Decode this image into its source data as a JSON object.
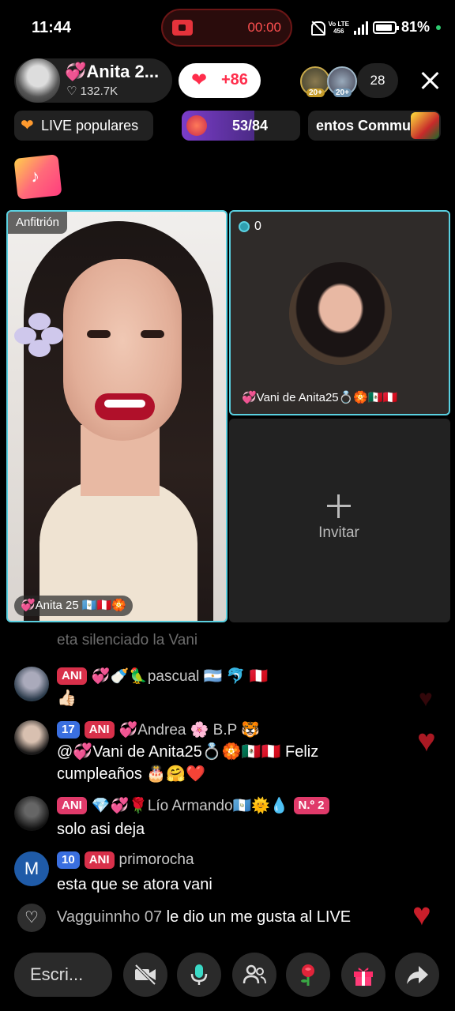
{
  "status_bar": {
    "time": "11:44",
    "recording_time": "00:00",
    "network": "Vo LTE",
    "network_speed": "456",
    "battery": "81%"
  },
  "host": {
    "name": "💞Anita 2...",
    "likes": "♡ 132.7K",
    "heart_count": "+86",
    "viewer_badges": [
      "20+",
      "20+"
    ],
    "viewer_count": "28"
  },
  "chips": {
    "live_popular": "LIVE populares",
    "rank": "53/84",
    "events": "entos Commu"
  },
  "panels": {
    "host_tag": "Anfitrión",
    "host_name": "💞Anita 25 🇬🇹🇵🇪🏵️",
    "guest_count": "0",
    "guest_name": "💞Vani de Anita25💍🏵️🇲🇽🇵🇪",
    "invite_label": "Invitar"
  },
  "chat": {
    "faded_message": "eta silenciado la Vani",
    "messages": [
      {
        "badges": [
          "ANI"
        ],
        "user": "💞🍼🦜pascual 🇦🇷 🐬 🇵🇪",
        "text": "👍🏻"
      },
      {
        "badges": [
          "17",
          "ANI"
        ],
        "user": "💞Andrea 🌸 B.P 🐯",
        "text": "@💞Vani de Anita25💍🏵️🇲🇽🇵🇪 Feliz cumpleaños 🎂🤗❤️"
      },
      {
        "badges": [
          "ANI"
        ],
        "user": "💎💞🌹Lío Armando🇬🇹🌞💧",
        "rank_badge": "N.º 2",
        "text": "solo asi deja"
      },
      {
        "avatar_letter": "M",
        "badges": [
          "10",
          "ANI"
        ],
        "user": "primorocha",
        "text": "esta que se atora vani"
      }
    ],
    "like_event": {
      "user": "Vagguinnho 07",
      "action": "le dio un me gusta al LIVE"
    }
  },
  "footer": {
    "comment_placeholder": "Escri...",
    "buttons": [
      "camera-off",
      "microphone",
      "multi-guest",
      "rose-gift",
      "gift",
      "share"
    ]
  },
  "colors": {
    "accent_cyan": "#5ad0e0",
    "heart_red": "#ff2d4b",
    "badge_blue": "#3a6fe0",
    "badge_red": "#d8304a"
  }
}
